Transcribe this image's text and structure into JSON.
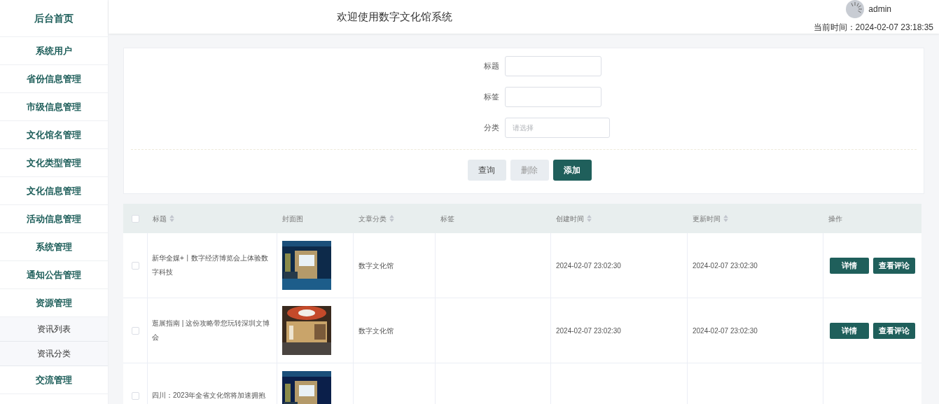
{
  "sidebar": {
    "items": [
      {
        "label": "后台首页",
        "kind": "home",
        "selected": false
      },
      {
        "label": "系统用户",
        "kind": "menu",
        "selected": false
      },
      {
        "label": "省份信息管理",
        "kind": "menu",
        "selected": false
      },
      {
        "label": "市级信息管理",
        "kind": "menu",
        "selected": false
      },
      {
        "label": "文化馆名管理",
        "kind": "menu",
        "selected": false
      },
      {
        "label": "文化类型管理",
        "kind": "menu",
        "selected": false
      },
      {
        "label": "文化信息管理",
        "kind": "menu",
        "selected": false
      },
      {
        "label": "活动信息管理",
        "kind": "menu",
        "selected": false
      },
      {
        "label": "系统管理",
        "kind": "menu",
        "selected": false
      },
      {
        "label": "通知公告管理",
        "kind": "menu",
        "selected": false
      },
      {
        "label": "资源管理",
        "kind": "menu",
        "selected": false,
        "children": [
          {
            "label": "资讯列表",
            "selected": false
          },
          {
            "label": "资讯分类",
            "selected": false
          }
        ]
      },
      {
        "label": "交流管理",
        "kind": "menu",
        "selected": false
      }
    ]
  },
  "header": {
    "title": "欢迎使用数字文化馆系统",
    "user": "admin",
    "time_label": "当前时间：",
    "time": "2024-02-07 23:18:35"
  },
  "search": {
    "fields": [
      {
        "label": "标题",
        "kind": "text"
      },
      {
        "label": "标签",
        "kind": "text"
      },
      {
        "label": "分类",
        "kind": "select",
        "placeholder": "请选择"
      }
    ],
    "buttons": [
      {
        "label": "查询",
        "kind": "plain"
      },
      {
        "label": "删除",
        "kind": "disabled"
      },
      {
        "label": "添加",
        "kind": "primary"
      }
    ]
  },
  "table": {
    "all_checked": false,
    "columns": [
      {
        "label": "标题",
        "sortable": true
      },
      {
        "label": "封面图",
        "sortable": false
      },
      {
        "label": "文章分类",
        "sortable": true
      },
      {
        "label": "标签",
        "sortable": false
      },
      {
        "label": "创建时间",
        "sortable": true
      },
      {
        "label": "更新时间",
        "sortable": true
      },
      {
        "label": "操作",
        "sortable": false
      }
    ],
    "rows": [
      {
        "checked": false,
        "title": "新华全媒+丨数字经济博览会上体验数字科技",
        "cover": {
          "kind": "picture"
        },
        "category": "数字文化馆",
        "created": "2024-02-07 23:02:30",
        "updated": "2024-02-07 23:02:30",
        "actions": [
          "详情",
          "查看评论"
        ]
      },
      {
        "checked": false,
        "title": "逛展指南 | 这份攻略带您玩转深圳文博会",
        "cover": {
          "kind": "picture"
        },
        "category": "数字文化馆",
        "created": "2024-02-07 23:02:30",
        "updated": "2024-02-07 23:02:30",
        "actions": [
          "详情",
          "查看评论"
        ]
      },
      {
        "checked": false,
        "title": "四川：2023年全省文化馆将加速拥抱",
        "cover": {
          "kind": "picture"
        }
      }
    ]
  }
}
